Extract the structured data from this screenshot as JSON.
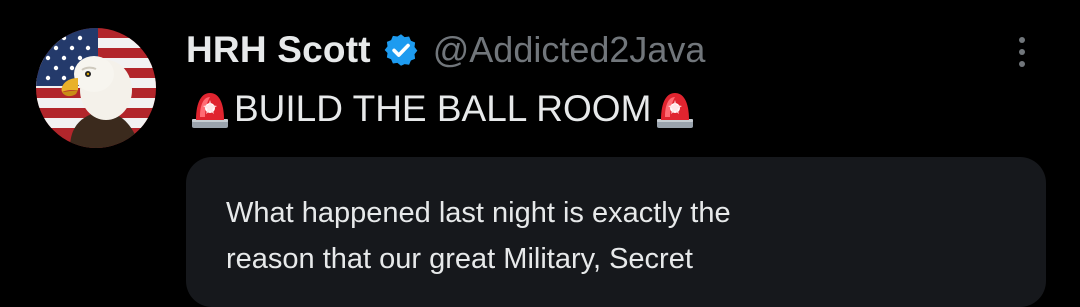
{
  "post": {
    "author": {
      "display_name": "HRH Scott",
      "handle": "@Addicted2Java",
      "verified": true,
      "avatar_icon": "bald-eagle-american-flag-avatar"
    },
    "more_icon": "vertical-ellipsis-icon",
    "text": "BUILD THE BALL ROOM",
    "text_emoji": "police-car-light-icon",
    "quoted": {
      "lines": [
        "What happened last night is exactly the",
        "reason that our great Military, Secret"
      ]
    }
  },
  "colors": {
    "background": "#000000",
    "primary_text": "#e7e9ea",
    "secondary_text": "#71767b",
    "verified_blue": "#1d9bf0",
    "card_background": "#16181c"
  }
}
